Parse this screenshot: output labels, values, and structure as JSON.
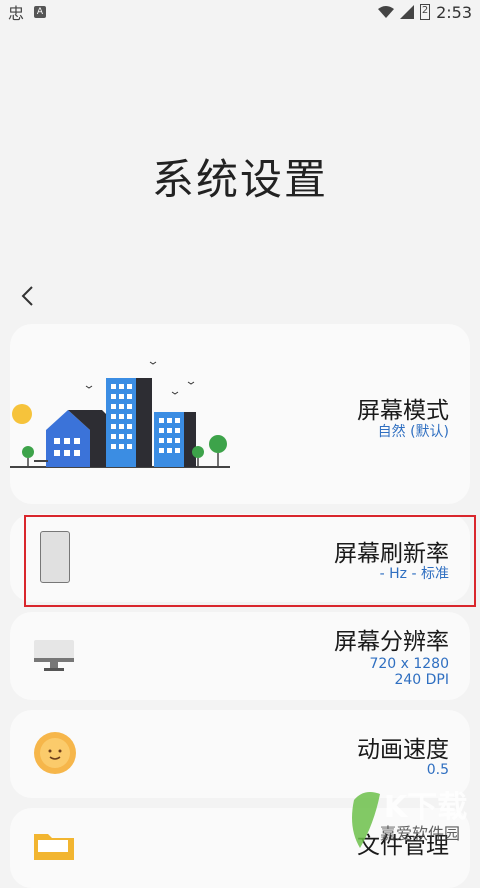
{
  "status": {
    "time": "2:53",
    "battery": "2"
  },
  "page_title": "系统设置",
  "cards": [
    {
      "title": "屏幕模式",
      "subtitle": "自然 (默认)"
    },
    {
      "title": "屏幕刷新率",
      "subtitle": "- Hz - 标准"
    },
    {
      "title": "屏幕分辨率",
      "subtitle_line1": "720 x 1280",
      "subtitle_line2": "240 DPI"
    },
    {
      "title": "动画速度",
      "subtitle": "0.5"
    },
    {
      "title": "文件管理"
    }
  ],
  "watermark": {
    "text": "K下载",
    "sub": "嘉爱软件园"
  }
}
